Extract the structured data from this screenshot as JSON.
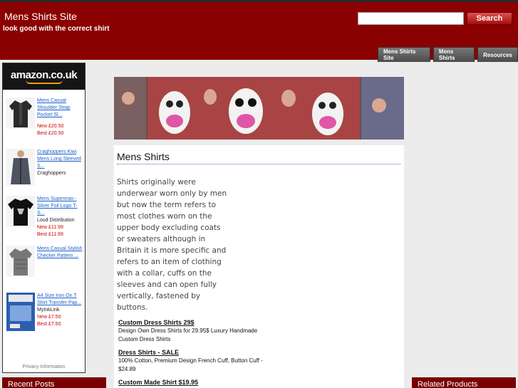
{
  "header": {
    "site_title": "Mens Shirts Site",
    "tagline": "look good with the correct shirt",
    "search_button": "Search",
    "search_value": ""
  },
  "nav": {
    "items": [
      {
        "label": "Mens Shirts Site"
      },
      {
        "label": "Mens Shirts"
      },
      {
        "label": "Resources"
      }
    ]
  },
  "sidebar": {
    "amazon_logo": "amazon.co.uk",
    "products": [
      {
        "title": "Mens Casual Shoulder Strap Pocket Sl...",
        "brand": "",
        "new_price": "New £20.50",
        "best_price": "Best £20.50"
      },
      {
        "title": "Craghoppers Kiwi Mens Long Sleeved S...",
        "brand": "Craghoppers",
        "new_price": "",
        "best_price": ""
      },
      {
        "title": "Mens Superman - Silver Foil Logo T-S...",
        "brand": "Loud Distribution",
        "new_price": "New £11.99",
        "best_price": "Best £11.99"
      },
      {
        "title": "Mens Casual Stylish Checker Pattern ...",
        "brand": "",
        "new_price": "",
        "best_price": ""
      },
      {
        "title": "A4 Size Iron On T Shirt Transfer Pap...",
        "brand": "MyInkLink",
        "new_price": "New £7.50",
        "best_price": "Best £7.50"
      }
    ],
    "privacy": "Privacy Information"
  },
  "widgets": {
    "recent_posts": "Recent Posts",
    "related_products": "Related Products"
  },
  "content": {
    "title": "Mens Shirts",
    "body": "Shirts originally were underwear worn only by men but now the term refers to most clothes worn on the upper body excluding coats or sweaters although in Britain it is more specific and refers to an item of clothing with a collar, cuffs on the sleeves and can open fully vertically, fastened by buttons.",
    "ads": [
      {
        "title": "Custom Dress Shirts 29$",
        "text": "Design Own Dress Shirts for 29.95$ Luxury Handmade Custom Dress Shirts"
      },
      {
        "title": "Dress Shirts - SALE",
        "text": "100% Cotton, Premium Design French Cuff, Button Cuff - $24.89"
      },
      {
        "title": "Custom Made Shirt $19.95",
        "text": ""
      }
    ]
  },
  "colors": {
    "header_bg": "#8b0000",
    "widget_bg": "#7a0000",
    "link": "#1a5fd1",
    "price": "#cc0000"
  }
}
